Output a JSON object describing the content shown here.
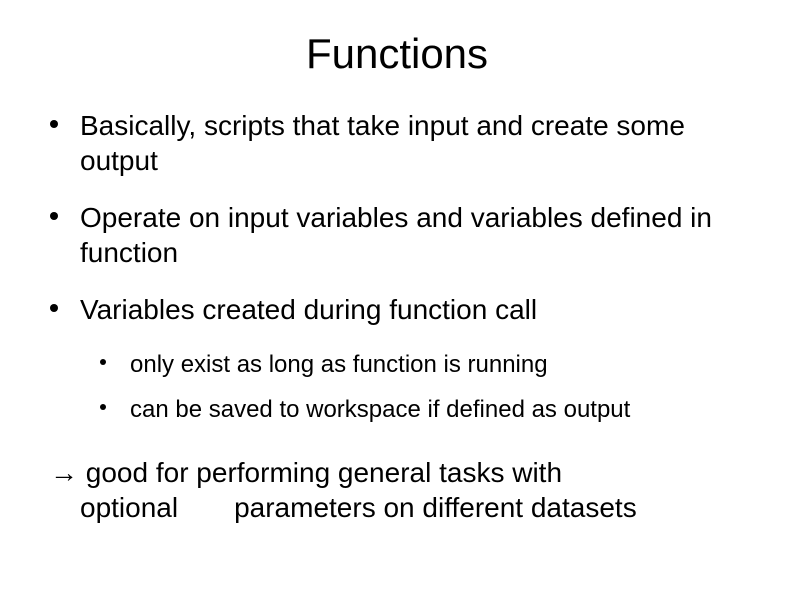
{
  "title": "Functions",
  "bullets": [
    "Basically, scripts that take input and create some output",
    "Operate on input variables and variables defined in function",
    "Variables created during function call"
  ],
  "sub_bullets": [
    "only exist as long as function is running",
    "can be saved to workspace if defined as output"
  ],
  "conclusion_arrow": "→",
  "conclusion_line1": " good for performing general tasks with",
  "conclusion_line2": "optional  parameters on different datasets"
}
